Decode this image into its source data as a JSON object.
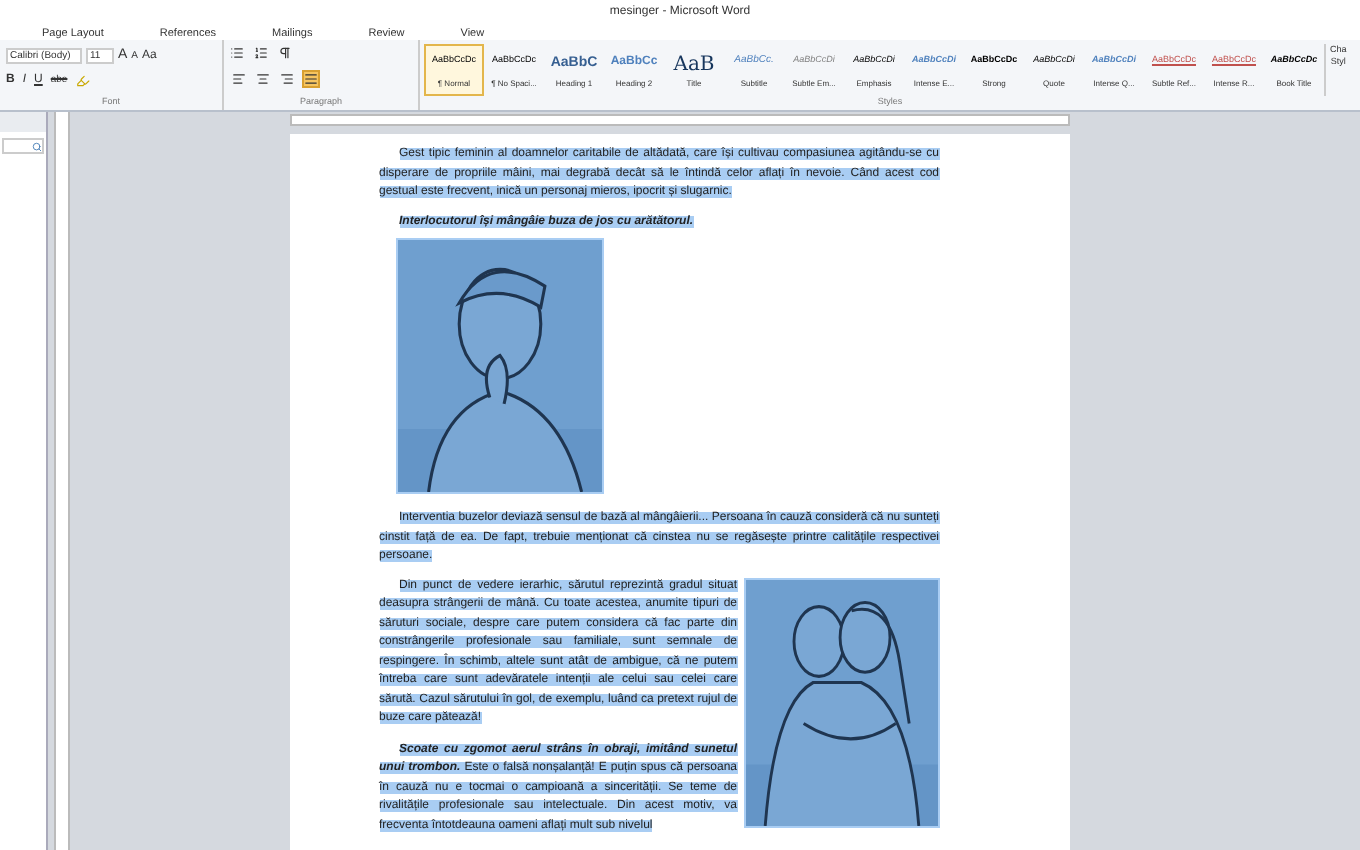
{
  "window": {
    "title": "mesinger - Microsoft Word"
  },
  "tabs": [
    {
      "label": "Page Layout",
      "selected": false
    },
    {
      "label": "References",
      "selected": false
    },
    {
      "label": "Mailings",
      "selected": false
    },
    {
      "label": "Review",
      "selected": false
    },
    {
      "label": "View",
      "selected": false
    }
  ],
  "font_group": {
    "font": "Calibri (Body)",
    "size": "11",
    "grow": "A",
    "shrink": "A",
    "case": "Aa",
    "bold": "B",
    "italic": "I",
    "underline": "U",
    "strike": "abe",
    "label": "Font"
  },
  "paragraph_group": {
    "label": "Paragraph",
    "alignments": [
      {
        "kind": "left",
        "selected": false
      },
      {
        "kind": "center",
        "selected": false
      },
      {
        "kind": "right",
        "selected": false
      },
      {
        "kind": "justify",
        "selected": true
      }
    ]
  },
  "styles_group": {
    "label": "Styles",
    "items": [
      {
        "preview": "AaBbCcDc",
        "name": "¶ Normal",
        "kind": "plain",
        "selected": true
      },
      {
        "preview": "AaBbCcDc",
        "name": "¶ No Spaci...",
        "kind": "plain",
        "selected": false
      },
      {
        "preview": "AaBbC",
        "name": "Heading 1",
        "kind": "heading",
        "selected": false
      },
      {
        "preview": "AaBbCc",
        "name": "Heading 2",
        "kind": "heading2",
        "selected": false
      },
      {
        "preview": "AaB",
        "name": "Title",
        "kind": "title",
        "selected": false
      },
      {
        "preview": "AaBbCc.",
        "name": "Subtitle",
        "kind": "subtitle",
        "selected": false
      },
      {
        "preview": "AaBbCcDi",
        "name": "Subtle Em...",
        "kind": "subtle",
        "selected": false
      },
      {
        "preview": "AaBbCcDi",
        "name": "Emphasis",
        "kind": "emphasis",
        "selected": false
      },
      {
        "preview": "AaBbCcDi",
        "name": "Intense E...",
        "kind": "intense",
        "selected": false
      },
      {
        "preview": "AaBbCcDc",
        "name": "Strong",
        "kind": "strong",
        "selected": false
      },
      {
        "preview": "AaBbCcDi",
        "name": "Quote",
        "kind": "emphasis",
        "selected": false
      },
      {
        "preview": "AaBbCcDi",
        "name": "Intense Q...",
        "kind": "intense",
        "selected": false
      },
      {
        "preview": "AaBbCcDc",
        "name": "Subtle Ref...",
        "kind": "ref",
        "selected": false
      },
      {
        "preview": "AaBbCcDc",
        "name": "Intense R...",
        "kind": "ref",
        "selected": false
      },
      {
        "preview": "AaBbCcDc",
        "name": "Book Title",
        "kind": "book",
        "selected": false
      }
    ],
    "change_styles": [
      "Cha",
      "Styl"
    ]
  },
  "document": {
    "selected": true,
    "blocks": [
      {
        "kind": "text",
        "text": "Gest tipic feminin al doamnelor caritabile de altădată, care își cultivau compasiunea agitându-se cu disperare de propriile mâini, mai degrabă decât să le întindă celor aflați în nevoie. Când acest cod gestual este frecvent, inică un personaj mieros, ipocrit și slugarnic."
      },
      {
        "kind": "caption",
        "text": "Interlocutorul își mângâie buza de jos cu arătătorul."
      },
      {
        "kind": "picture"
      },
      {
        "kind": "text",
        "text": "Interventia buzelor deviază sensul de bază al mângâierii... Persoana în cauză consideră că nu sunteți cinstit față de ea. De fapt, trebuie menționat că cinstea nu se regăsește printre calitățile respectivei persoane."
      },
      {
        "kind": "float",
        "paragraphs": [
          "Din punct de vedere ierarhic, sărutul reprezintă gradul situat deasupra strângerii de mână. Cu toate acestea, anumite tipuri de săruturi sociale, despre care putem considera că fac parte din constrângerile profesionale sau familiale, sunt semnale de respingere. În schimb, altele sunt atât de ambigue, că ne putem întreba care sunt adevăratele intenții ale celui sau celei care sărută. Cazul sărutului în gol, de exemplu, luând ca pretext rujul de buze care pătează!",
          "**Scoate cu zgomot aerul strâns în obraji, imitând sunetul unui trombon.** Este o falsă nonșalanță! E puțin spus că persoana în cauză nu e tocmai o campioană a sincerității. Se teme de rivalitățile profesionale sau intelectuale. Din acest motiv, va frecventa întotdeauna oameni aflați mult sub nivelul"
        ]
      }
    ]
  }
}
